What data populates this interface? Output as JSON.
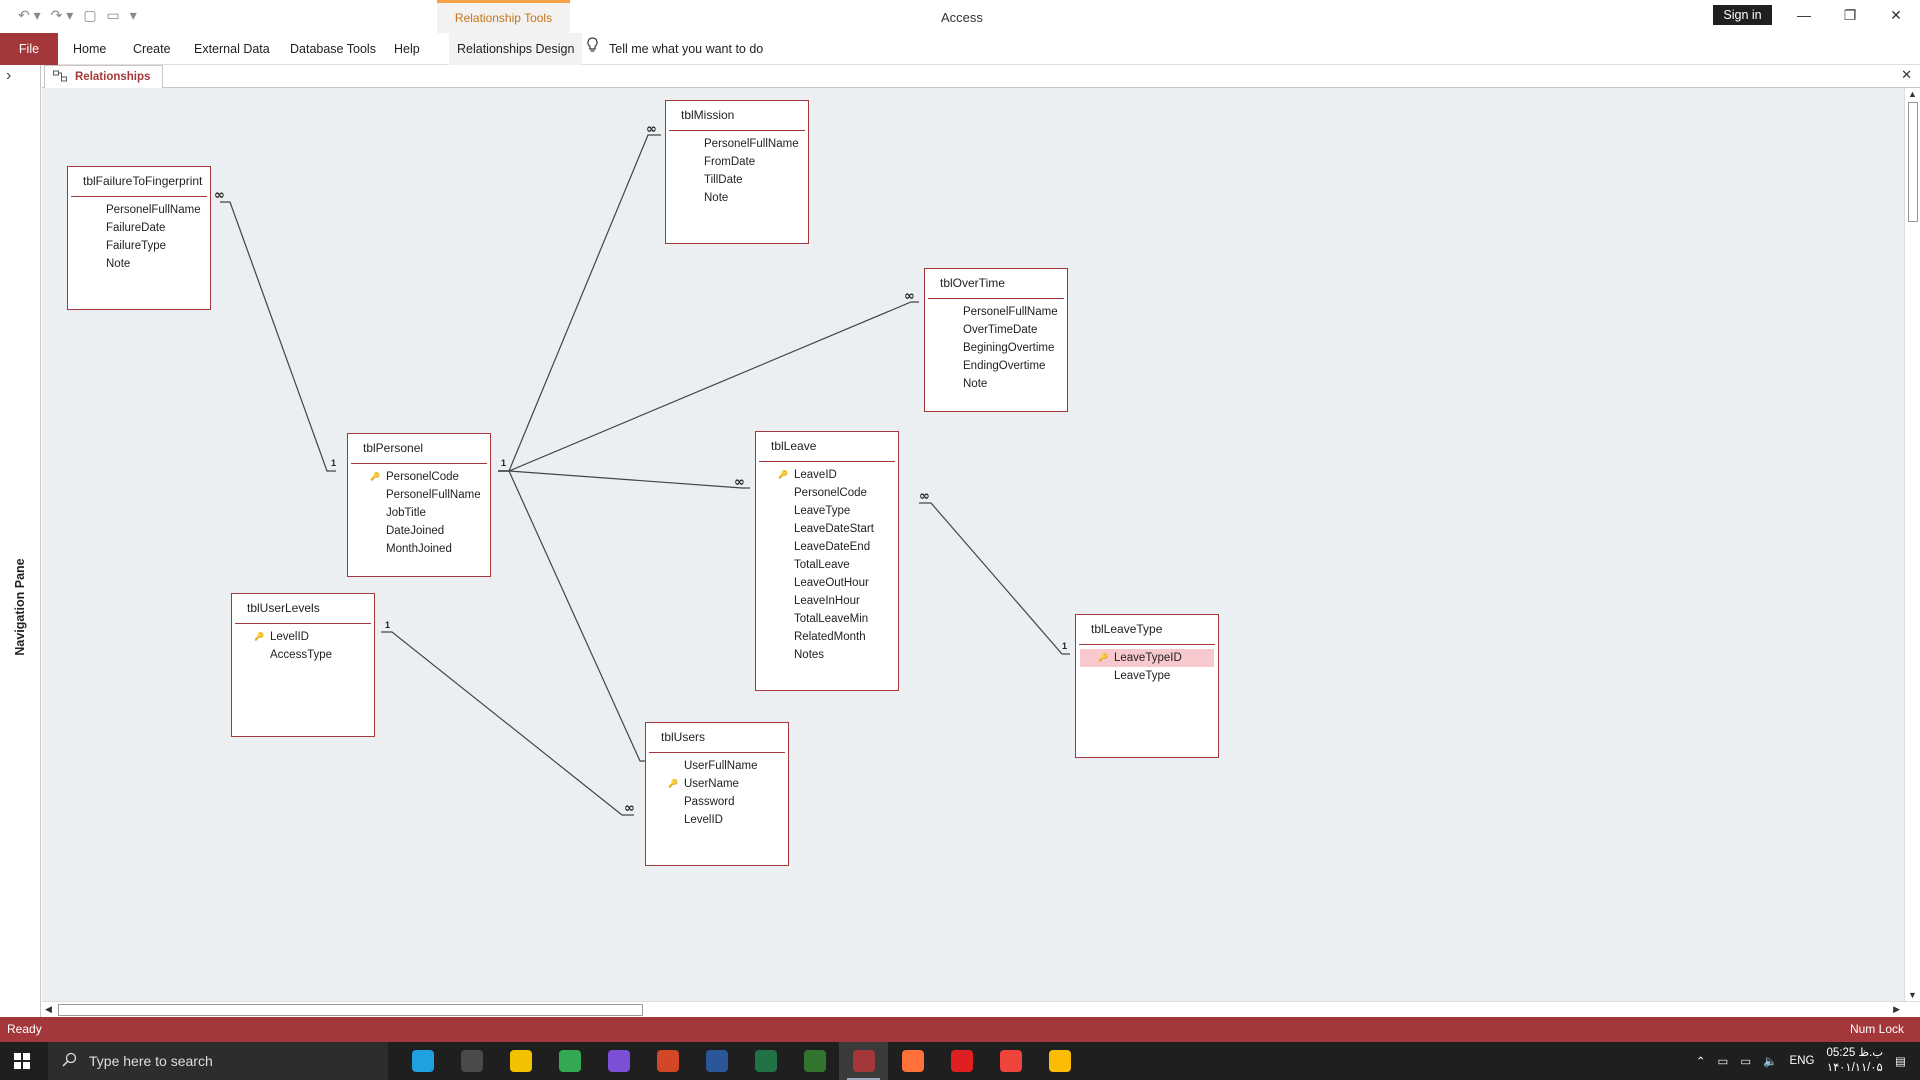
{
  "app": {
    "title": "Access",
    "sign_in": "Sign in",
    "context_tab_group": "Relationship Tools"
  },
  "ribbon": {
    "file": "File",
    "tabs": [
      "Home",
      "Create",
      "External Data",
      "Database Tools",
      "Help",
      "Relationships Design"
    ],
    "tell_me": "Tell me what you want to do"
  },
  "nav_pane": {
    "label": "Navigation Pane"
  },
  "document_tab": {
    "label": "Relationships"
  },
  "tables": [
    {
      "name": "tblFailureToFingerprint",
      "fields": [
        {
          "n": "PersonelFullName"
        },
        {
          "n": "FailureDate"
        },
        {
          "n": "FailureType"
        },
        {
          "n": "Note"
        }
      ]
    },
    {
      "name": "tblMission",
      "fields": [
        {
          "n": "PersonelFullName"
        },
        {
          "n": "FromDate"
        },
        {
          "n": "TillDate"
        },
        {
          "n": "Note"
        }
      ]
    },
    {
      "name": "tblOverTime",
      "fields": [
        {
          "n": "PersonelFullName"
        },
        {
          "n": "OverTimeDate"
        },
        {
          "n": "BeginingOvertime"
        },
        {
          "n": "EndingOvertime"
        },
        {
          "n": "Note"
        }
      ]
    },
    {
      "name": "tblPersonel",
      "fields": [
        {
          "n": "PersonelCode",
          "key": true
        },
        {
          "n": "PersonelFullName"
        },
        {
          "n": "JobTitle"
        },
        {
          "n": "DateJoined"
        },
        {
          "n": "MonthJoined"
        }
      ]
    },
    {
      "name": "tblLeave",
      "fields": [
        {
          "n": "LeaveID",
          "key": true
        },
        {
          "n": "PersonelCode"
        },
        {
          "n": "LeaveType"
        },
        {
          "n": "LeaveDateStart"
        },
        {
          "n": "LeaveDateEnd"
        },
        {
          "n": "TotalLeave"
        },
        {
          "n": "LeaveOutHour"
        },
        {
          "n": "LeaveInHour"
        },
        {
          "n": "TotalLeaveMin"
        },
        {
          "n": "RelatedMonth"
        },
        {
          "n": "Notes"
        }
      ]
    },
    {
      "name": "tblUserLevels",
      "fields": [
        {
          "n": "LevelID",
          "key": true
        },
        {
          "n": "AccessType"
        }
      ]
    },
    {
      "name": "tblLeaveType",
      "fields": [
        {
          "n": "LeaveTypeID",
          "key": true,
          "selected": true
        },
        {
          "n": "LeaveType"
        }
      ]
    },
    {
      "name": "tblUsers",
      "fields": [
        {
          "n": "UserFullName"
        },
        {
          "n": "UserName",
          "key": true
        },
        {
          "n": "Password"
        },
        {
          "n": "LevelID"
        }
      ]
    }
  ],
  "relationships": [
    {
      "from": "tblPersonel",
      "to": "tblFailureToFingerprint",
      "one": "1",
      "many": "∞"
    },
    {
      "from": "tblPersonel",
      "to": "tblMission",
      "one": "1",
      "many": "∞"
    },
    {
      "from": "tblPersonel",
      "to": "tblOverTime",
      "one": "1",
      "many": "∞"
    },
    {
      "from": "tblPersonel",
      "to": "tblLeave",
      "one": "1",
      "many": "∞"
    },
    {
      "from": "tblPersonel",
      "to": "tblUsers",
      "one": "1",
      "many": "∞"
    },
    {
      "from": "tblLeaveType",
      "to": "tblLeave",
      "one": "1",
      "many": "∞"
    },
    {
      "from": "tblUserLevels",
      "to": "tblUsers",
      "one": "1",
      "many": "∞"
    }
  ],
  "status": {
    "left": "Ready",
    "right": "Num Lock"
  },
  "taskbar": {
    "search_placeholder": "Type here to search",
    "apps": [
      {
        "name": "edge",
        "color": "#1fa1e0"
      },
      {
        "name": "calculator",
        "color": "#4a4a4a"
      },
      {
        "name": "file-explorer",
        "color": "#f2c200"
      },
      {
        "name": "chrome",
        "color": "#34a853"
      },
      {
        "name": "tor-app",
        "color": "#7b4fd6"
      },
      {
        "name": "powerpoint",
        "color": "#d24726"
      },
      {
        "name": "word",
        "color": "#2b579a"
      },
      {
        "name": "excel",
        "color": "#217346"
      },
      {
        "name": "project",
        "color": "#31752f"
      },
      {
        "name": "access",
        "color": "#a4373a",
        "active": true
      },
      {
        "name": "firefox",
        "color": "#ff7139"
      },
      {
        "name": "flash-app",
        "color": "#e02020"
      },
      {
        "name": "anydesk",
        "color": "#ef443b"
      },
      {
        "name": "chrome-2",
        "color": "#fbbc05"
      }
    ],
    "language": "ENG",
    "time": "05:25 ب.ظ",
    "date": "۱۴۰۱/۱۱/۰۵"
  }
}
